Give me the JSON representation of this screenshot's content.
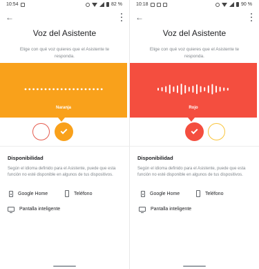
{
  "screens": [
    {
      "status": {
        "time": "10:54",
        "battery": "82 %"
      },
      "title": "Voz del Asistente",
      "subtitle": "Elige con qué voz quieres que el Asistente te responda.",
      "voice_label": "Naranja",
      "band_color": "#F9A11B",
      "wave_style": "dots",
      "circles": [
        {
          "color": "#E55A4D",
          "selected": false
        },
        {
          "color": "#F9A11B",
          "selected": true
        }
      ],
      "section_title": "Disponibilidad",
      "section_desc": "Según el idioma definido para el Asistente, puede que esta función no esté disponible en algunos de tus dispositivos.",
      "devices": [
        "Google Home",
        "Teléfono",
        "Pantalla inteligente"
      ]
    },
    {
      "status": {
        "time": "10:18",
        "battery": "90 %"
      },
      "title": "Voz del Asistente",
      "subtitle": "Elige con qué voz quieres que el Asistente te responda.",
      "voice_label": "Rojo",
      "band_color": "#F44E3F",
      "wave_style": "bars",
      "circles": [
        {
          "color": "#F44E3F",
          "selected": true
        },
        {
          "color": "#F9C43B",
          "selected": false
        }
      ],
      "section_title": "Disponibilidad",
      "section_desc": "Según el idioma definido para el Asistente, puede que esta función no esté disponible en algunos de tus dispositivos.",
      "devices": [
        "Google Home",
        "Teléfono",
        "Pantalla inteligente"
      ]
    }
  ],
  "icons": {
    "back": "arrow-left-icon",
    "menu": "more-vert-icon",
    "speaker": "speaker-icon",
    "phone": "phone-icon",
    "display": "smart-display-icon"
  }
}
